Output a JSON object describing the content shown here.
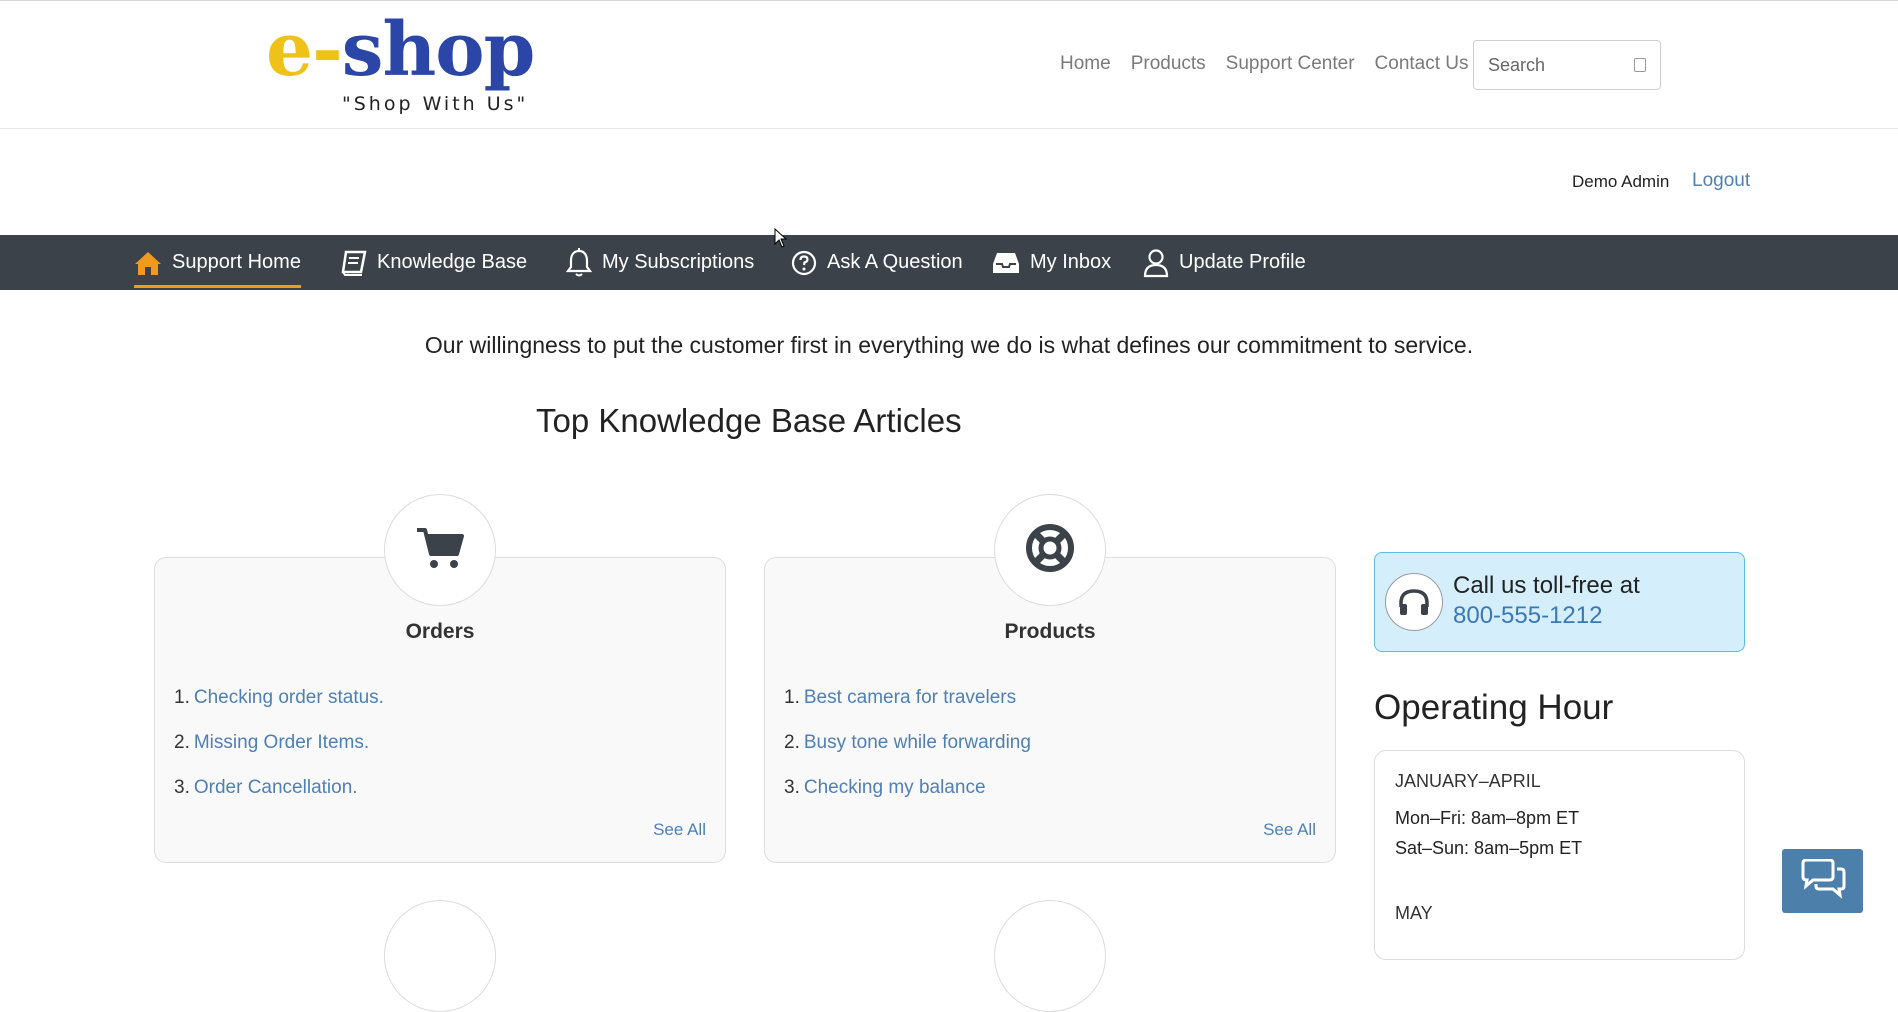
{
  "header": {
    "logo_e": "e-",
    "logo_shop": "shop",
    "logo_tagline": "\"Shop With Us\"",
    "nav": [
      "Home",
      "Products",
      "Support Center",
      "Contact Us"
    ],
    "search_placeholder": "Search"
  },
  "user": {
    "name": "Demo Admin",
    "logout": "Logout"
  },
  "support_nav": [
    {
      "label": "Support Home",
      "icon": "home-icon",
      "active": true
    },
    {
      "label": "Knowledge Base",
      "icon": "book-icon"
    },
    {
      "label": "My Subscriptions",
      "icon": "bell-icon"
    },
    {
      "label": "Ask A Question",
      "icon": "question-circle-icon"
    },
    {
      "label": "My Inbox",
      "icon": "inbox-icon"
    },
    {
      "label": "Update Profile",
      "icon": "user-icon"
    }
  ],
  "tagline": "Our willingness to put the customer first in everything we do is what defines our commitment to service.",
  "section_title": "Top Knowledge Base Articles",
  "cards": [
    {
      "title": "Orders",
      "icon": "cart-icon",
      "articles": [
        "Checking order status.",
        "Missing Order Items.",
        "Order Cancellation."
      ],
      "see_all": "See All"
    },
    {
      "title": "Products",
      "icon": "lifebuoy-icon",
      "articles": [
        "Best camera for travelers",
        "Busy tone while forwarding",
        "Checking my balance"
      ],
      "see_all": "See All"
    }
  ],
  "call": {
    "text": "Call us toll-free at",
    "phone": "800-555-1212",
    "icon": "headset-icon"
  },
  "operating": {
    "title": "Operating Hour",
    "period1": "JANUARY–APRIL",
    "weekday": "Mon–Fri: 8am–8pm ET",
    "weekend": "Sat–Sun: 8am–5pm ET",
    "period2": "MAY"
  },
  "colors": {
    "nav_bg": "#3b4249",
    "active_accent": "#f29a1d",
    "link": "#4e7fb5",
    "call_bg": "#d4eefb",
    "chat_btn": "#4d7fab"
  }
}
